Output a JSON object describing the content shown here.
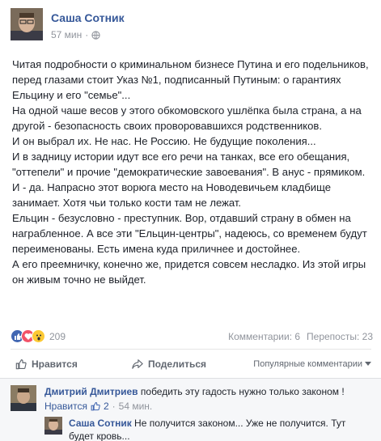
{
  "post": {
    "author": "Саша Сотник",
    "time": "57 мин",
    "separator": "·",
    "paragraphs": [
      "Читая подробности о криминальном бизнесе Путина и его подельников, перед глазами стоит Указ №1, подписанный Путиным: о гарантиях Ельцину и его \"семье\"...",
      "На одной чаше весов у этого обкомовского ушлёпка была страна, а на другой - безопасность своих проворовавшихся родственников.",
      "И он выбрал их. Не нас. Не Россию. Не будущие поколения...",
      "И в задницу истории идут все его речи на танках, все его обещания, \"оттепели\" и прочие \"демократические завоевания\". В анус - прямиком.",
      "И - да. Напрасно этот ворюга место на Новодевичьем кладбище занимает. Хотя чьи только кости там не лежат.",
      "Ельцин - безусловно - преступник. Вор, отдавший страну в обмен на награбленное. А все эти \"Ельцин-центры\", надеюсь, со временем будут переименованы. Есть имена куда приличнее и достойнее.",
      "А его преемничку, конечно же, придется совсем несладко. Из этой игры он живым точно не выйдет."
    ]
  },
  "stats": {
    "reactions_count": "209",
    "comments": "Комментарии: 6",
    "shares": "Перепосты: 23"
  },
  "actions": {
    "like": "Нравится",
    "share": "Поделиться",
    "sort": "Популярные комментарии"
  },
  "comments": [
    {
      "author": "Дмитрий Дмитриев",
      "text": "победить эту гадость нужно только законом !",
      "like_label": "Нравится",
      "likes": "2",
      "separator": "·",
      "time": "54 мин."
    },
    {
      "author": "Саша Сотник",
      "text": "Не получится законом... Уже не получится. Тут будет кровь..."
    }
  ],
  "colors": {
    "link": "#365899",
    "meta": "#90949c",
    "like_reaction": "#4267b2",
    "love_reaction": "#f25268",
    "wow_reaction": "#fcc934"
  }
}
